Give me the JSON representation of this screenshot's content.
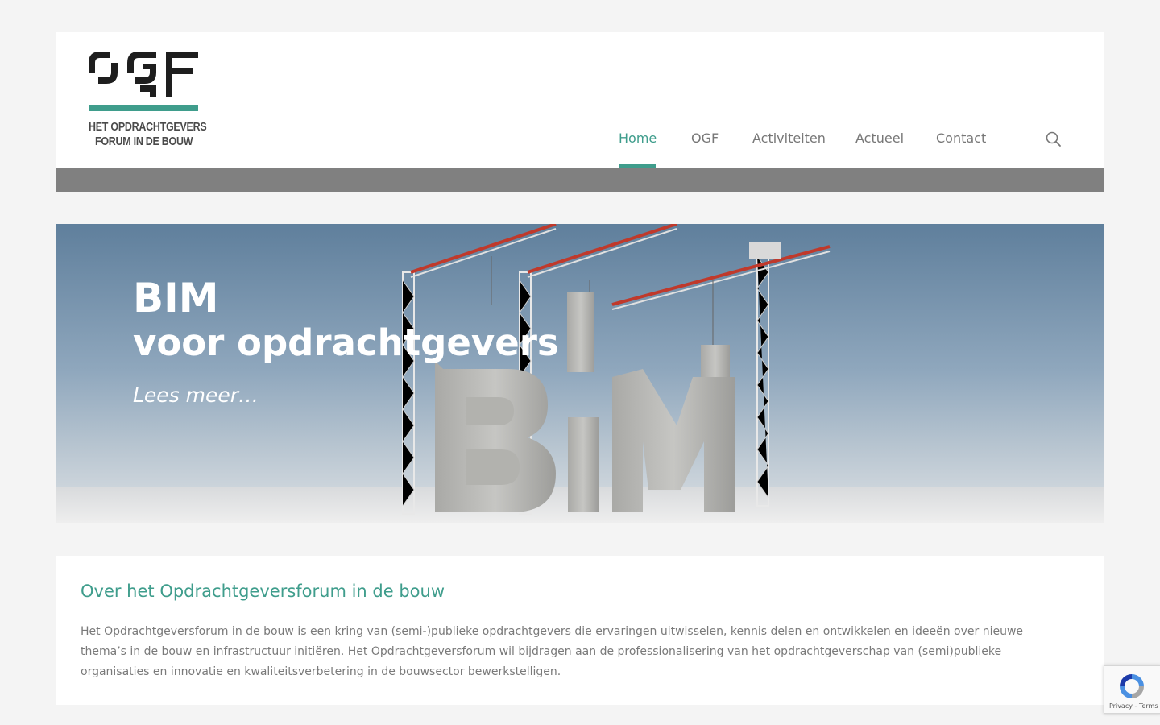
{
  "logo": {
    "mark": "OGF",
    "line1": "HET OPDRACHTGEVERS",
    "line2": "FORUM IN DE BOUW",
    "mark_color": "#1e1e1e",
    "accent_color": "#3f9d8c"
  },
  "nav": {
    "items": [
      {
        "label": "Home",
        "active": true
      },
      {
        "label": "OGF",
        "active": false
      },
      {
        "label": "Activiteiten",
        "active": false
      },
      {
        "label": "Actueel",
        "active": false
      },
      {
        "label": "Contact",
        "active": false
      }
    ],
    "search_icon": "search-icon"
  },
  "hero": {
    "title": "BIM",
    "subtitle": "voor opdrachtgevers",
    "link": "Lees meer…"
  },
  "about": {
    "title": "Over het Opdrachtgeversforum in de bouw",
    "text": "Het Opdrachtgeversforum in de bouw is een kring van (semi-)publieke opdrachtgevers die ervaringen uitwisselen, kennis delen en ontwikkelen en ideeën over nieuwe thema’s in de bouw en infrastructuur initiëren. Het Opdrachtgeversforum wil bijdragen aan de professionalisering van het opdrachtgeverschap van (semi)publieke organisaties en innovatie en kwaliteitsverbetering in de bouwsector bewerkstelligen."
  },
  "recaptcha": {
    "links": "Privacy - Terms"
  },
  "colors": {
    "accent": "#3f9d8c",
    "page_bg": "#f4f4f4",
    "band": "#808080"
  }
}
